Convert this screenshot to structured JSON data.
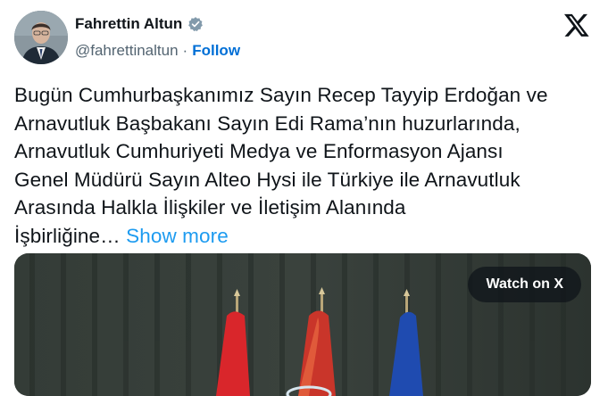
{
  "author": {
    "name": "Fahrettin Altun",
    "handle": "@fahrettinaltun",
    "separator": "·",
    "follow_label": "Follow"
  },
  "tweet": {
    "lines": [
      "Bugün Cumhurbaşkanımız Sayın Recep Tayyip Erdoğan ve",
      "Arnavutluk Başbakanı Sayın Edi Rama’nın huzurlarında,",
      "Arnavutluk Cumhuriyeti Medya ve Enformasyon Ajansı",
      "Genel Müdürü Sayın Alteo Hysi ile Türkiye ile Arnavutluk",
      "Arasında Halkla İlişkiler ve İletişim Alanında"
    ],
    "last_line": "İşbirliğine…",
    "show_more_label": "Show more"
  },
  "media": {
    "watch_label": "Watch on X"
  },
  "colors": {
    "accent": "#1d9bf0",
    "follow": "#006fd6",
    "verified": "#829aab"
  },
  "icons": {
    "verified": "verified-badge-icon",
    "logo": "x-logo-icon"
  }
}
